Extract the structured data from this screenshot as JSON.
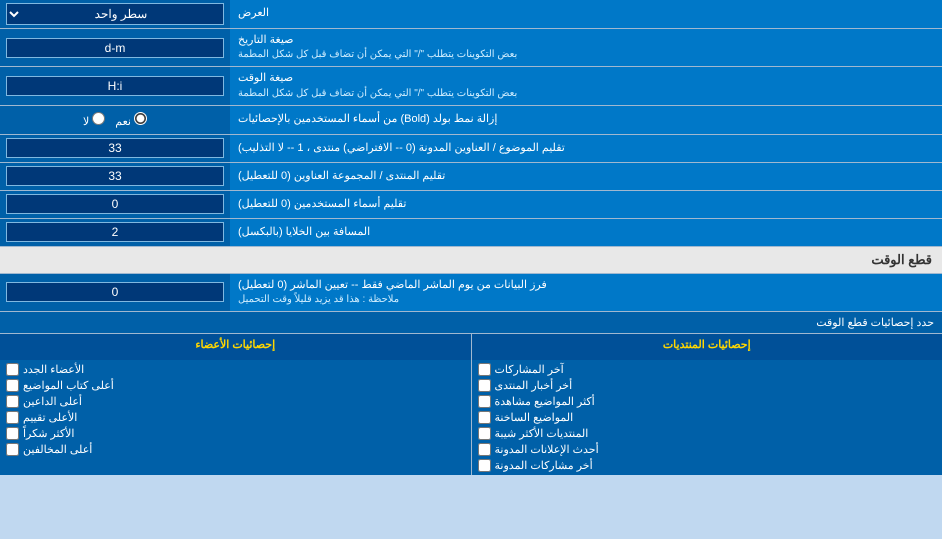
{
  "page": {
    "title": "العرض"
  },
  "rows": [
    {
      "id": "single-line",
      "label": "العرض",
      "input_type": "select",
      "value": "سطر واحد",
      "options": [
        "سطر واحد"
      ]
    },
    {
      "id": "date-format",
      "label": "صيغة التاريخ",
      "sublabel": "بعض التكوينات يتطلب \"/\" التي يمكن أن تضاف قبل كل شكل المطمة",
      "input_type": "text",
      "value": "d-m"
    },
    {
      "id": "time-format",
      "label": "صيغة الوقت",
      "sublabel": "بعض التكوينات يتطلب \"/\" التي يمكن أن تضاف قبل كل شكل المطمة",
      "input_type": "text",
      "value": "H:i"
    },
    {
      "id": "remove-bold",
      "label": "إزالة نمط بولد (Bold) من أسماء المستخدمين بالإحصائيات",
      "input_type": "radio",
      "options": [
        "نعم",
        "لا"
      ],
      "selected": "نعم"
    },
    {
      "id": "topic-titles",
      "label": "تقليم الموضوع / العناوين المدونة (0 -- الافتراضي) منتدى ، 1 -- لا التذليب)",
      "input_type": "text",
      "value": "33"
    },
    {
      "id": "forum-titles",
      "label": "تقليم المنتدى / المجموعة العناوين (0 للتعطيل)",
      "input_type": "text",
      "value": "33"
    },
    {
      "id": "user-names",
      "label": "تقليم أسماء المستخدمين (0 للتعطيل)",
      "input_type": "text",
      "value": "0"
    },
    {
      "id": "cell-spacing",
      "label": "المسافة بين الخلايا (بالبكسل)",
      "input_type": "text",
      "value": "2"
    }
  ],
  "section_realtime": {
    "title": "قطع الوقت",
    "row": {
      "label": "فرز البيانات من يوم الماشر الماضي فقط -- تعيين الماشر (0 لتعطيل)",
      "sublabel": "ملاحظة : هذا قد يزيد قليلاً وقت التحميل",
      "input_value": "0"
    },
    "stats_header": "حدد إحصائيات قطع الوقت",
    "col1_header": "إحصائيات المنتديات",
    "col2_header": "إحصائيات الأعضاء",
    "col1_items": [
      "آخر المشاركات",
      "أخر أخبار المنتدى",
      "أكثر المواضيع مشاهدة",
      "المواضيع الساخنة",
      "المنتديات الأكثر شيبة",
      "أحدث الإعلانات المدونة",
      "أخر مشاركات المدونة"
    ],
    "col2_items": [
      "الأعضاء الجدد",
      "أعلى كتاب المواضيع",
      "أعلى الداعين",
      "الأعلى تقييم",
      "الأكثر شكراً",
      "أعلى المخالفين"
    ]
  }
}
